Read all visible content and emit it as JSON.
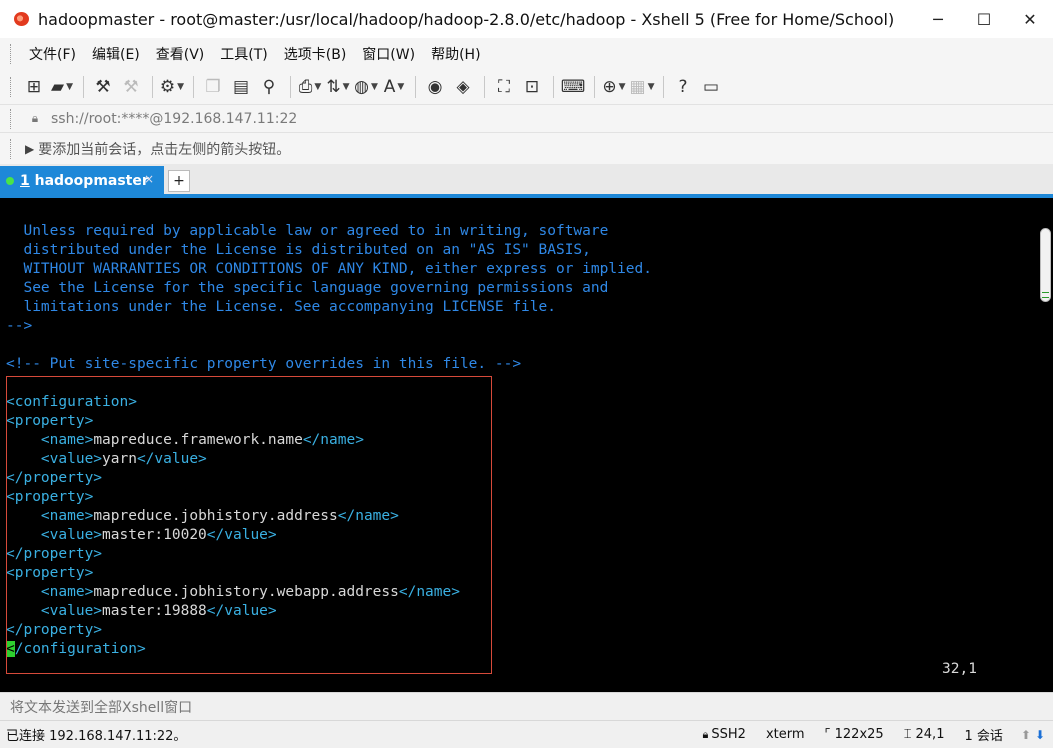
{
  "window": {
    "title": "hadoopmaster - root@master:/usr/local/hadoop/hadoop-2.8.0/etc/hadoop - Xshell 5 (Free for Home/School)",
    "minimize": "─",
    "maximize": "☐",
    "close": "✕"
  },
  "menu": {
    "items": [
      "文件(F)",
      "编辑(E)",
      "查看(V)",
      "工具(T)",
      "选项卡(B)",
      "窗口(W)",
      "帮助(H)"
    ]
  },
  "toolbar": {
    "icons": [
      "new-session-icon",
      "open-folder-icon",
      "reconnect-icon",
      "disconnect-icon",
      "properties-icon",
      "copy-icon",
      "paste-icon",
      "find-icon",
      "print-icon",
      "transfer-icon",
      "globe-icon",
      "font-icon",
      "xftp-icon",
      "xagent-icon",
      "fullscreen-icon",
      "lock-icon",
      "keyboard-icon",
      "add-pane-icon",
      "layout-icon",
      "help-icon",
      "chat-icon"
    ]
  },
  "address": {
    "value": "ssh://root:****@192.168.147.11:22"
  },
  "hint": {
    "text": "要添加当前会话，点击左侧的箭头按钮。"
  },
  "tabs": [
    {
      "number": "1",
      "label": "hadoopmaster",
      "close": "×"
    }
  ],
  "tab_add": "+",
  "terminal": {
    "license_lines": [
      "  Unless required by applicable law or agreed to in writing, software",
      "  distributed under the License is distributed on an \"AS IS\" BASIS,",
      "  WITHOUT WARRANTIES OR CONDITIONS OF ANY KIND, either express or implied.",
      "  See the License for the specific language governing permissions and",
      "  limitations under the License. See accompanying LICENSE file."
    ],
    "comment_end": "-->",
    "site_comment": "<!-- Put site-specific property overrides in this file. -->",
    "config_open": "<configuration>",
    "config_close_rest": "/configuration>",
    "cursor_char": "<",
    "property_open": "<property>",
    "property_close": "</property>",
    "name_open": "<name>",
    "name_close": "</name>",
    "value_open": "<value>",
    "value_close": "</value>",
    "properties": [
      {
        "name": "mapreduce.framework.name",
        "value": "yarn"
      },
      {
        "name": "mapreduce.jobhistory.address",
        "value": "master:10020"
      },
      {
        "name": "mapreduce.jobhistory.webapp.address",
        "value": "master:19888"
      }
    ],
    "cursor_position": "32,1"
  },
  "send_bar": {
    "text": "将文本发送到全部Xshell窗口"
  },
  "status": {
    "connection": "已连接 192.168.147.11:22。",
    "protocol": "SSH2",
    "terminal_type": "xterm",
    "size": "122x25",
    "cursor": "24,1",
    "sessions": "1 会话"
  }
}
